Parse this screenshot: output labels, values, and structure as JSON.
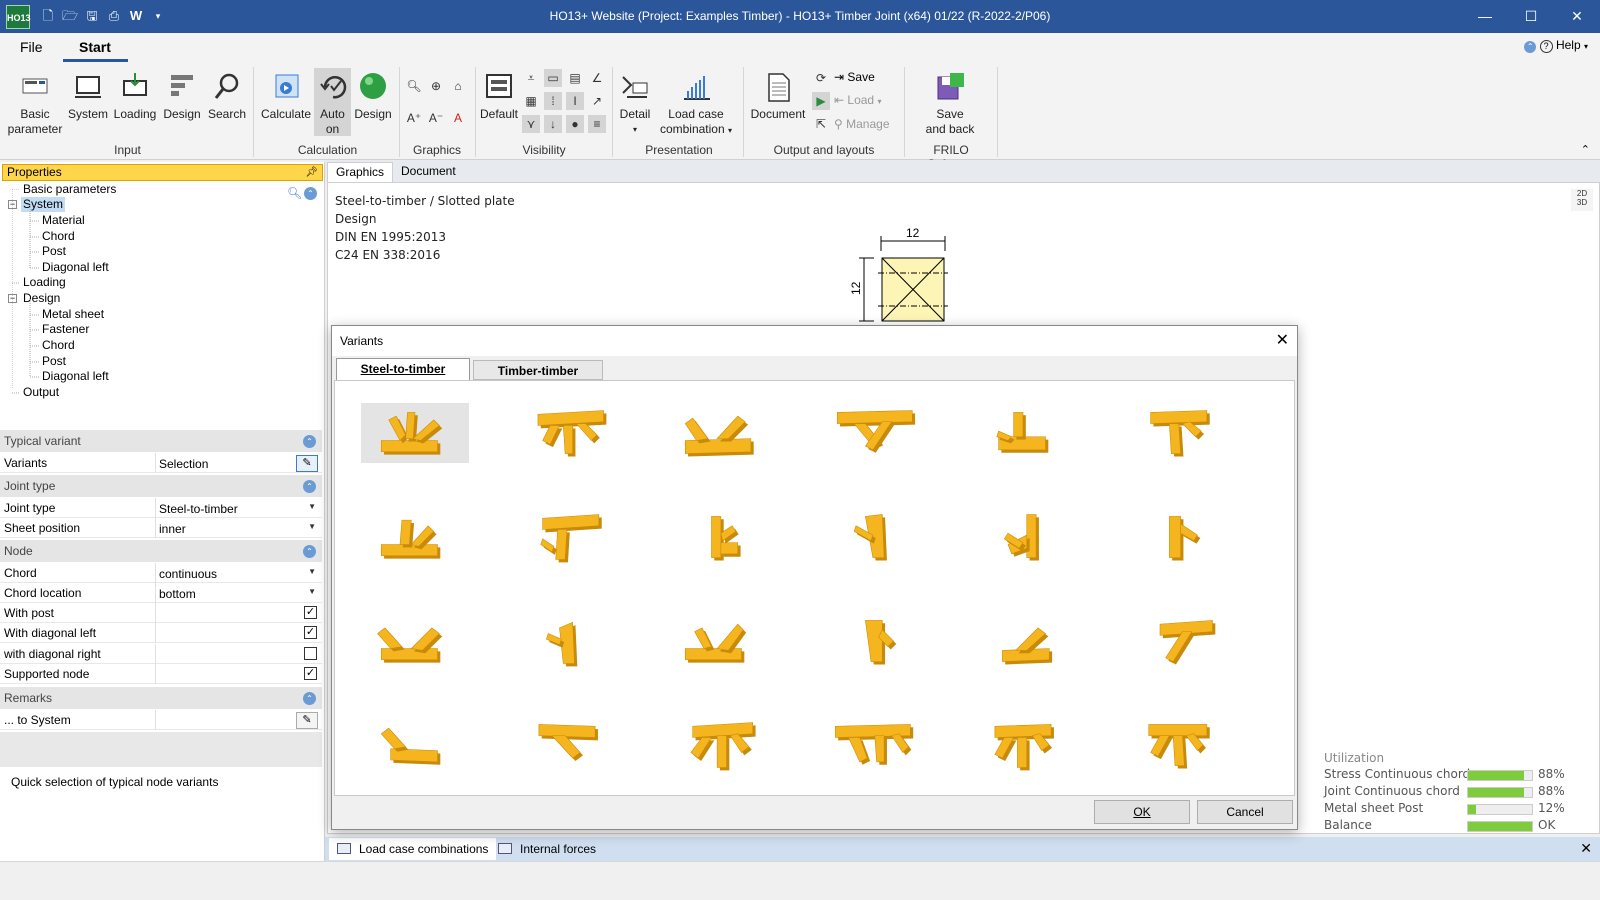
{
  "window": {
    "title": "HO13+ Website (Project: Examples Timber) - HO13+ Timber Joint (x64) 01/22 (R-2022-2/P06)",
    "app_logo": "HO13",
    "qat_w": "W"
  },
  "menu": {
    "file": "File",
    "start": "Start",
    "help": "Help"
  },
  "ribbon": {
    "basic": [
      "Basic",
      "parameter"
    ],
    "system": "System",
    "loading": "Loading",
    "design": "Design",
    "search": "Search",
    "calculate": "Calculate",
    "auto": [
      "Auto",
      "on"
    ],
    "design2": "Design",
    "default": "Default",
    "detail": "Detail",
    "lcc": [
      "Load case",
      "combination"
    ],
    "document": "Document",
    "save": "Save",
    "load": "Load",
    "manage": "Manage",
    "saveback": [
      "Save",
      "and back"
    ],
    "groups": [
      "Input",
      "Calculation",
      "Graphics",
      "Visibility",
      "Presentation",
      "Output and layouts",
      "FRILO Software"
    ]
  },
  "left": {
    "header": "Properties",
    "tree": {
      "basic": "Basic parameters",
      "system": "System",
      "material": "Material",
      "chord": "Chord",
      "post": "Post",
      "diag": "Diagonal left",
      "loading": "Loading",
      "design": "Design",
      "metal": "Metal sheet",
      "fastener": "Fastener",
      "chord2": "Chord",
      "post2": "Post",
      "diag2": "Diagonal left",
      "output": "Output"
    },
    "sections": {
      "typical": "Typical variant",
      "joint": "Joint type",
      "node": "Node",
      "remarks": "Remarks"
    },
    "rows": {
      "variants_l": "Variants",
      "variants_v": "Selection",
      "jointtype_l": "Joint type",
      "jointtype_v": "Steel-to-timber",
      "sheet_l": "Sheet position",
      "sheet_v": "inner",
      "chord_l": "Chord",
      "chord_v": "continuous",
      "chordloc_l": "Chord location",
      "chordloc_v": "bottom",
      "withpost": "With post",
      "withdiagl": "With diagonal left",
      "withdiagr": "with diagonal right",
      "supported": "Supported node",
      "tosystem": "... to System"
    },
    "checks": {
      "withpost": true,
      "withdiagl": true,
      "withdiagr": false,
      "supported": true
    },
    "description": "Quick selection of typical node variants"
  },
  "main": {
    "tabs": [
      "Graphics",
      "Document"
    ],
    "info": [
      "Steel-to-timber / Slotted plate",
      "Design",
      "DIN EN 1995:2013",
      "C24 EN 338:2016"
    ],
    "dim": [
      "2D",
      "3D"
    ],
    "section_dims": [
      "12",
      "12"
    ]
  },
  "utilization": {
    "title": "Utilization",
    "rows": [
      {
        "label": "Stress Continuous chord",
        "value": "88%",
        "fill": 0.88
      },
      {
        "label": "Joint Continuous chord",
        "value": "88%",
        "fill": 0.88
      },
      {
        "label": "Metal sheet Post",
        "value": "12%",
        "fill": 0.12
      },
      {
        "label": "Balance",
        "value": "OK",
        "fill": 1.0
      }
    ]
  },
  "bottom_tabs": [
    "Load case combinations",
    "Internal forces"
  ],
  "dialog": {
    "title": "Variants",
    "tabs": [
      "Steel-to-timber",
      "Timber-timber"
    ],
    "ok": "OK",
    "cancel": "Cancel"
  },
  "colors": {
    "titlebar": "#2b579a",
    "timber": "#f5b51e",
    "timber_dark": "#c88a08",
    "util_fill": "#7ecb3c",
    "panel_header": "#ffd54a"
  }
}
